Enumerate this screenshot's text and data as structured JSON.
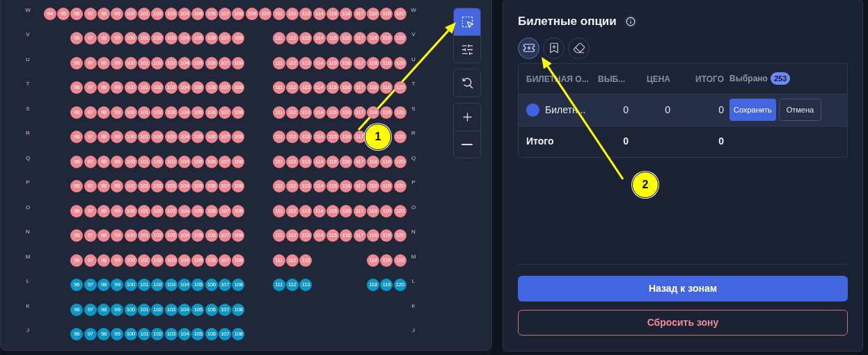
{
  "seat_map": {
    "rows": [
      {
        "label": "W",
        "label_end": "W",
        "color": "#ef8890",
        "sections": [
          {
            "kind": "wing_left",
            "seats": [
              "94",
              "95"
            ]
          },
          {
            "kind": "main_left",
            "seats": [
              "96",
              "97",
              "98",
              "99",
              "100",
              "101",
              "102",
              "103",
              "104",
              "105",
              "106",
              "107",
              "108"
            ]
          },
          {
            "kind": "aisle",
            "seats": [
              "109",
              "110"
            ]
          },
          {
            "kind": "main_right",
            "seats": [
              "111",
              "112",
              "113",
              "114",
              "115",
              "116",
              "117",
              "118",
              "119",
              "120"
            ]
          }
        ]
      },
      {
        "label": "V",
        "label_end": "V",
        "color": "#ef8890",
        "sections": [
          {
            "kind": "main_left",
            "seats": [
              "96",
              "97",
              "98",
              "99",
              "100",
              "101",
              "102",
              "103",
              "104",
              "105",
              "106",
              "107",
              "108"
            ]
          },
          {
            "kind": "main_right",
            "seats": [
              "111",
              "112",
              "113",
              "114",
              "115",
              "116",
              "117",
              "118",
              "119",
              "120"
            ]
          }
        ]
      },
      {
        "label": "U",
        "label_end": "U",
        "color": "#ef8890",
        "sections": [
          {
            "kind": "main_left",
            "seats": [
              "96",
              "97",
              "98",
              "99",
              "100",
              "101",
              "102",
              "103",
              "104",
              "105",
              "106",
              "107",
              "108"
            ]
          },
          {
            "kind": "main_right",
            "seats": [
              "111",
              "112",
              "113",
              "114",
              "115",
              "116",
              "117",
              "118",
              "119",
              "120"
            ]
          }
        ]
      },
      {
        "label": "T",
        "label_end": "T",
        "color": "#ef8890",
        "sections": [
          {
            "kind": "main_left",
            "seats": [
              "96",
              "97",
              "98",
              "99",
              "100",
              "101",
              "102",
              "103",
              "104",
              "105",
              "106",
              "107",
              "108"
            ]
          },
          {
            "kind": "main_right",
            "seats": [
              "111",
              "112",
              "113",
              "114",
              "115",
              "116",
              "117",
              "118",
              "119",
              "120"
            ]
          }
        ]
      },
      {
        "label": "S",
        "label_end": "S",
        "color": "#ef8890",
        "sections": [
          {
            "kind": "main_left",
            "seats": [
              "96",
              "97",
              "98",
              "99",
              "100",
              "101",
              "102",
              "103",
              "104",
              "105",
              "106",
              "107",
              "108"
            ]
          },
          {
            "kind": "main_right",
            "seats": [
              "111",
              "112",
              "113",
              "114",
              "115",
              "116",
              "117",
              "118",
              "119",
              "120"
            ]
          }
        ]
      },
      {
        "label": "R",
        "label_end": "R",
        "color": "#ef8890",
        "sections": [
          {
            "kind": "main_left",
            "seats": [
              "96",
              "97",
              "98",
              "99",
              "100",
              "101",
              "102",
              "103",
              "104",
              "105",
              "106",
              "107",
              "108"
            ]
          },
          {
            "kind": "main_right",
            "seats": [
              "111",
              "112",
              "113",
              "114",
              "115",
              "116",
              "117"
            ]
          },
          {
            "kind": "end",
            "seats": [
              "120"
            ]
          }
        ]
      },
      {
        "label": "Q",
        "label_end": "Q",
        "color": "#ef8890",
        "sections": [
          {
            "kind": "main_left",
            "seats": [
              "96",
              "97",
              "98",
              "99",
              "100",
              "101",
              "102",
              "103",
              "104",
              "105",
              "106",
              "107",
              "108"
            ]
          },
          {
            "kind": "main_right",
            "seats": [
              "111",
              "112",
              "113",
              "114",
              "115",
              "116",
              "117",
              "118",
              "119",
              "120"
            ]
          }
        ]
      },
      {
        "label": "P",
        "label_end": "P",
        "color": "#ef8890",
        "sections": [
          {
            "kind": "main_left",
            "seats": [
              "96",
              "97",
              "98",
              "99",
              "100",
              "101",
              "102",
              "103",
              "104",
              "105",
              "106",
              "107",
              "108"
            ]
          },
          {
            "kind": "main_right",
            "seats": [
              "111",
              "112",
              "113",
              "114",
              "115",
              "116",
              "117",
              "118",
              "119",
              "120"
            ]
          }
        ]
      },
      {
        "label": "O",
        "label_end": "O",
        "color": "#ef8890",
        "sections": [
          {
            "kind": "main_left",
            "seats": [
              "96",
              "97",
              "98",
              "99",
              "100",
              "101",
              "102",
              "103",
              "104",
              "105",
              "106",
              "107",
              "108"
            ]
          },
          {
            "kind": "main_right",
            "seats": [
              "111",
              "112",
              "113",
              "114",
              "115",
              "116",
              "117",
              "118",
              "119",
              "120"
            ]
          }
        ]
      },
      {
        "label": "N",
        "label_end": "N",
        "color": "#ef8890",
        "sections": [
          {
            "kind": "main_left",
            "seats": [
              "96",
              "97",
              "98",
              "99",
              "100",
              "101",
              "102",
              "103",
              "104",
              "105",
              "106",
              "107",
              "108"
            ]
          },
          {
            "kind": "main_right",
            "seats": [
              "111",
              "112",
              "113",
              "114",
              "115",
              "116",
              "117",
              "118",
              "119",
              "120"
            ]
          }
        ]
      },
      {
        "label": "M",
        "label_end": "M",
        "color": "#ef8890",
        "sections": [
          {
            "kind": "main_left",
            "seats": [
              "96",
              "97",
              "98",
              "99",
              "100",
              "101",
              "102",
              "103",
              "104",
              "105",
              "106",
              "107",
              "108"
            ]
          },
          {
            "kind": "main_right",
            "seats": [
              "111",
              "112",
              "113"
            ]
          },
          {
            "kind": "wing_right",
            "seats": [
              "118",
              "119",
              "120"
            ]
          }
        ]
      },
      {
        "label": "L",
        "label_end": "L",
        "color": "#0b98c6",
        "sections": [
          {
            "kind": "main_left",
            "seats": [
              "96",
              "97",
              "98",
              "99",
              "100",
              "101",
              "102",
              "103",
              "104",
              "105",
              "106",
              "107",
              "108"
            ]
          },
          {
            "kind": "main_right",
            "seats": [
              "111",
              "112",
              "113"
            ]
          },
          {
            "kind": "wing_right",
            "seats": [
              "118",
              "119",
              "120"
            ]
          }
        ]
      },
      {
        "label": "K",
        "label_end": "K",
        "color": "#0b98c6",
        "sections": [
          {
            "kind": "main_left",
            "seats": [
              "96",
              "97",
              "98",
              "99",
              "100",
              "101",
              "102",
              "103",
              "104",
              "105",
              "106",
              "107",
              "108"
            ]
          }
        ]
      },
      {
        "label": "J",
        "label_end": "J",
        "color": "#0b98c6",
        "sections": [
          {
            "kind": "main_left",
            "seats": [
              "96",
              "97",
              "98",
              "99",
              "100",
              "101",
              "102",
              "103",
              "104",
              "105",
              "106",
              "107",
              "108"
            ]
          }
        ]
      }
    ],
    "tool_groups": [
      [
        {
          "kind": "select",
          "selected": true
        },
        {
          "kind": "filter",
          "selected": false
        }
      ],
      [
        {
          "kind": "reset_zoom",
          "selected": false
        }
      ],
      [
        {
          "kind": "zoom_in",
          "selected": false
        },
        {
          "kind": "zoom_out",
          "selected": false
        }
      ]
    ]
  },
  "panel": {
    "title": "Билетные опции",
    "modes": [
      {
        "kind": "ticket",
        "selected": true
      },
      {
        "kind": "bookmark",
        "selected": false
      },
      {
        "kind": "eraser",
        "selected": false
      }
    ],
    "table": {
      "columns": [
        "БИЛЕТНАЯ О...",
        "ВЫБ...",
        "ЦЕНА",
        "ИТОГО"
      ],
      "selected_label": "Выбрано",
      "selected_count": "253",
      "rows": [
        {
          "color": "#3f63e0",
          "cells": [
            "Билетн...",
            "0",
            "0",
            "0"
          ],
          "actions": [
            "Сохранить",
            "Отмена"
          ]
        }
      ],
      "total": {
        "cells": [
          "Итого",
          "0",
          null,
          "0"
        ]
      }
    },
    "buttons": [
      {
        "kind": "primary",
        "label": "Назад к зонам"
      },
      {
        "kind": "danger",
        "label": "Сбросить зону"
      }
    ]
  },
  "annotations": [
    {
      "number": "1"
    },
    {
      "number": "2"
    }
  ]
}
